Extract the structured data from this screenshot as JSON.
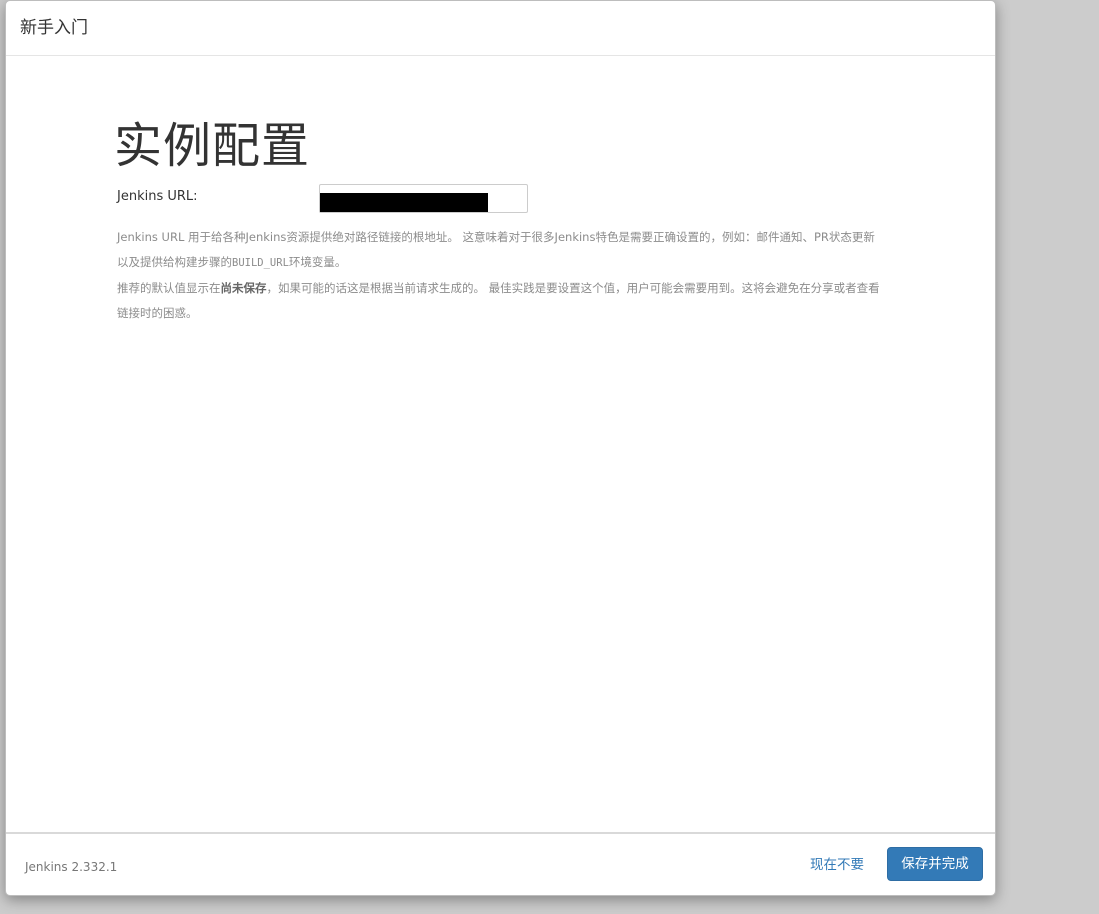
{
  "header": {
    "title": "新手入门"
  },
  "main": {
    "title": "实例配置",
    "url_label": "Jenkins URL:",
    "help": {
      "p1": "Jenkins URL 用于给各种Jenkins资源提供绝对路径链接的根地址。 这意味着对于很多Jenkins特色是需要正确设置的，例如：邮件通知、PR状态更新以及提供给构建步骤的",
      "p1_code": "BUILD_URL",
      "p1_end": "环境变量。",
      "p2_start": "推荐的默认值显示在",
      "p2_strong": "尚未保存",
      "p2_end": "，如果可能的话这是根据当前请求生成的。 最佳实践是要设置这个值，用户可能会需要用到。这将会避免在分享或者查看链接时的困惑。"
    }
  },
  "footer": {
    "version": "Jenkins 2.332.1",
    "skip_label": "现在不要",
    "save_label": "保存并完成"
  },
  "colors": {
    "accent": "#337ab7",
    "overlay": "#cccccc"
  }
}
